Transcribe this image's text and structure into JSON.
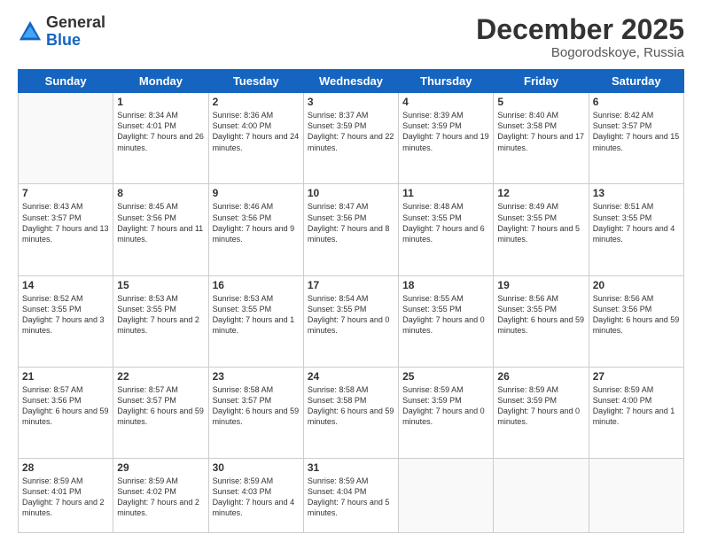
{
  "header": {
    "logo_general": "General",
    "logo_blue": "Blue",
    "month_title": "December 2025",
    "subtitle": "Bogorodskoye, Russia"
  },
  "days_of_week": [
    "Sunday",
    "Monday",
    "Tuesday",
    "Wednesday",
    "Thursday",
    "Friday",
    "Saturday"
  ],
  "weeks": [
    [
      {
        "day": "",
        "sunrise": "",
        "sunset": "",
        "daylight": ""
      },
      {
        "day": "1",
        "sunrise": "Sunrise: 8:34 AM",
        "sunset": "Sunset: 4:01 PM",
        "daylight": "Daylight: 7 hours and 26 minutes."
      },
      {
        "day": "2",
        "sunrise": "Sunrise: 8:36 AM",
        "sunset": "Sunset: 4:00 PM",
        "daylight": "Daylight: 7 hours and 24 minutes."
      },
      {
        "day": "3",
        "sunrise": "Sunrise: 8:37 AM",
        "sunset": "Sunset: 3:59 PM",
        "daylight": "Daylight: 7 hours and 22 minutes."
      },
      {
        "day": "4",
        "sunrise": "Sunrise: 8:39 AM",
        "sunset": "Sunset: 3:59 PM",
        "daylight": "Daylight: 7 hours and 19 minutes."
      },
      {
        "day": "5",
        "sunrise": "Sunrise: 8:40 AM",
        "sunset": "Sunset: 3:58 PM",
        "daylight": "Daylight: 7 hours and 17 minutes."
      },
      {
        "day": "6",
        "sunrise": "Sunrise: 8:42 AM",
        "sunset": "Sunset: 3:57 PM",
        "daylight": "Daylight: 7 hours and 15 minutes."
      }
    ],
    [
      {
        "day": "7",
        "sunrise": "Sunrise: 8:43 AM",
        "sunset": "Sunset: 3:57 PM",
        "daylight": "Daylight: 7 hours and 13 minutes."
      },
      {
        "day": "8",
        "sunrise": "Sunrise: 8:45 AM",
        "sunset": "Sunset: 3:56 PM",
        "daylight": "Daylight: 7 hours and 11 minutes."
      },
      {
        "day": "9",
        "sunrise": "Sunrise: 8:46 AM",
        "sunset": "Sunset: 3:56 PM",
        "daylight": "Daylight: 7 hours and 9 minutes."
      },
      {
        "day": "10",
        "sunrise": "Sunrise: 8:47 AM",
        "sunset": "Sunset: 3:56 PM",
        "daylight": "Daylight: 7 hours and 8 minutes."
      },
      {
        "day": "11",
        "sunrise": "Sunrise: 8:48 AM",
        "sunset": "Sunset: 3:55 PM",
        "daylight": "Daylight: 7 hours and 6 minutes."
      },
      {
        "day": "12",
        "sunrise": "Sunrise: 8:49 AM",
        "sunset": "Sunset: 3:55 PM",
        "daylight": "Daylight: 7 hours and 5 minutes."
      },
      {
        "day": "13",
        "sunrise": "Sunrise: 8:51 AM",
        "sunset": "Sunset: 3:55 PM",
        "daylight": "Daylight: 7 hours and 4 minutes."
      }
    ],
    [
      {
        "day": "14",
        "sunrise": "Sunrise: 8:52 AM",
        "sunset": "Sunset: 3:55 PM",
        "daylight": "Daylight: 7 hours and 3 minutes."
      },
      {
        "day": "15",
        "sunrise": "Sunrise: 8:53 AM",
        "sunset": "Sunset: 3:55 PM",
        "daylight": "Daylight: 7 hours and 2 minutes."
      },
      {
        "day": "16",
        "sunrise": "Sunrise: 8:53 AM",
        "sunset": "Sunset: 3:55 PM",
        "daylight": "Daylight: 7 hours and 1 minute."
      },
      {
        "day": "17",
        "sunrise": "Sunrise: 8:54 AM",
        "sunset": "Sunset: 3:55 PM",
        "daylight": "Daylight: 7 hours and 0 minutes."
      },
      {
        "day": "18",
        "sunrise": "Sunrise: 8:55 AM",
        "sunset": "Sunset: 3:55 PM",
        "daylight": "Daylight: 7 hours and 0 minutes."
      },
      {
        "day": "19",
        "sunrise": "Sunrise: 8:56 AM",
        "sunset": "Sunset: 3:55 PM",
        "daylight": "Daylight: 6 hours and 59 minutes."
      },
      {
        "day": "20",
        "sunrise": "Sunrise: 8:56 AM",
        "sunset": "Sunset: 3:56 PM",
        "daylight": "Daylight: 6 hours and 59 minutes."
      }
    ],
    [
      {
        "day": "21",
        "sunrise": "Sunrise: 8:57 AM",
        "sunset": "Sunset: 3:56 PM",
        "daylight": "Daylight: 6 hours and 59 minutes."
      },
      {
        "day": "22",
        "sunrise": "Sunrise: 8:57 AM",
        "sunset": "Sunset: 3:57 PM",
        "daylight": "Daylight: 6 hours and 59 minutes."
      },
      {
        "day": "23",
        "sunrise": "Sunrise: 8:58 AM",
        "sunset": "Sunset: 3:57 PM",
        "daylight": "Daylight: 6 hours and 59 minutes."
      },
      {
        "day": "24",
        "sunrise": "Sunrise: 8:58 AM",
        "sunset": "Sunset: 3:58 PM",
        "daylight": "Daylight: 6 hours and 59 minutes."
      },
      {
        "day": "25",
        "sunrise": "Sunrise: 8:59 AM",
        "sunset": "Sunset: 3:59 PM",
        "daylight": "Daylight: 7 hours and 0 minutes."
      },
      {
        "day": "26",
        "sunrise": "Sunrise: 8:59 AM",
        "sunset": "Sunset: 3:59 PM",
        "daylight": "Daylight: 7 hours and 0 minutes."
      },
      {
        "day": "27",
        "sunrise": "Sunrise: 8:59 AM",
        "sunset": "Sunset: 4:00 PM",
        "daylight": "Daylight: 7 hours and 1 minute."
      }
    ],
    [
      {
        "day": "28",
        "sunrise": "Sunrise: 8:59 AM",
        "sunset": "Sunset: 4:01 PM",
        "daylight": "Daylight: 7 hours and 2 minutes."
      },
      {
        "day": "29",
        "sunrise": "Sunrise: 8:59 AM",
        "sunset": "Sunset: 4:02 PM",
        "daylight": "Daylight: 7 hours and 2 minutes."
      },
      {
        "day": "30",
        "sunrise": "Sunrise: 8:59 AM",
        "sunset": "Sunset: 4:03 PM",
        "daylight": "Daylight: 7 hours and 4 minutes."
      },
      {
        "day": "31",
        "sunrise": "Sunrise: 8:59 AM",
        "sunset": "Sunset: 4:04 PM",
        "daylight": "Daylight: 7 hours and 5 minutes."
      },
      {
        "day": "",
        "sunrise": "",
        "sunset": "",
        "daylight": ""
      },
      {
        "day": "",
        "sunrise": "",
        "sunset": "",
        "daylight": ""
      },
      {
        "day": "",
        "sunrise": "",
        "sunset": "",
        "daylight": ""
      }
    ]
  ]
}
